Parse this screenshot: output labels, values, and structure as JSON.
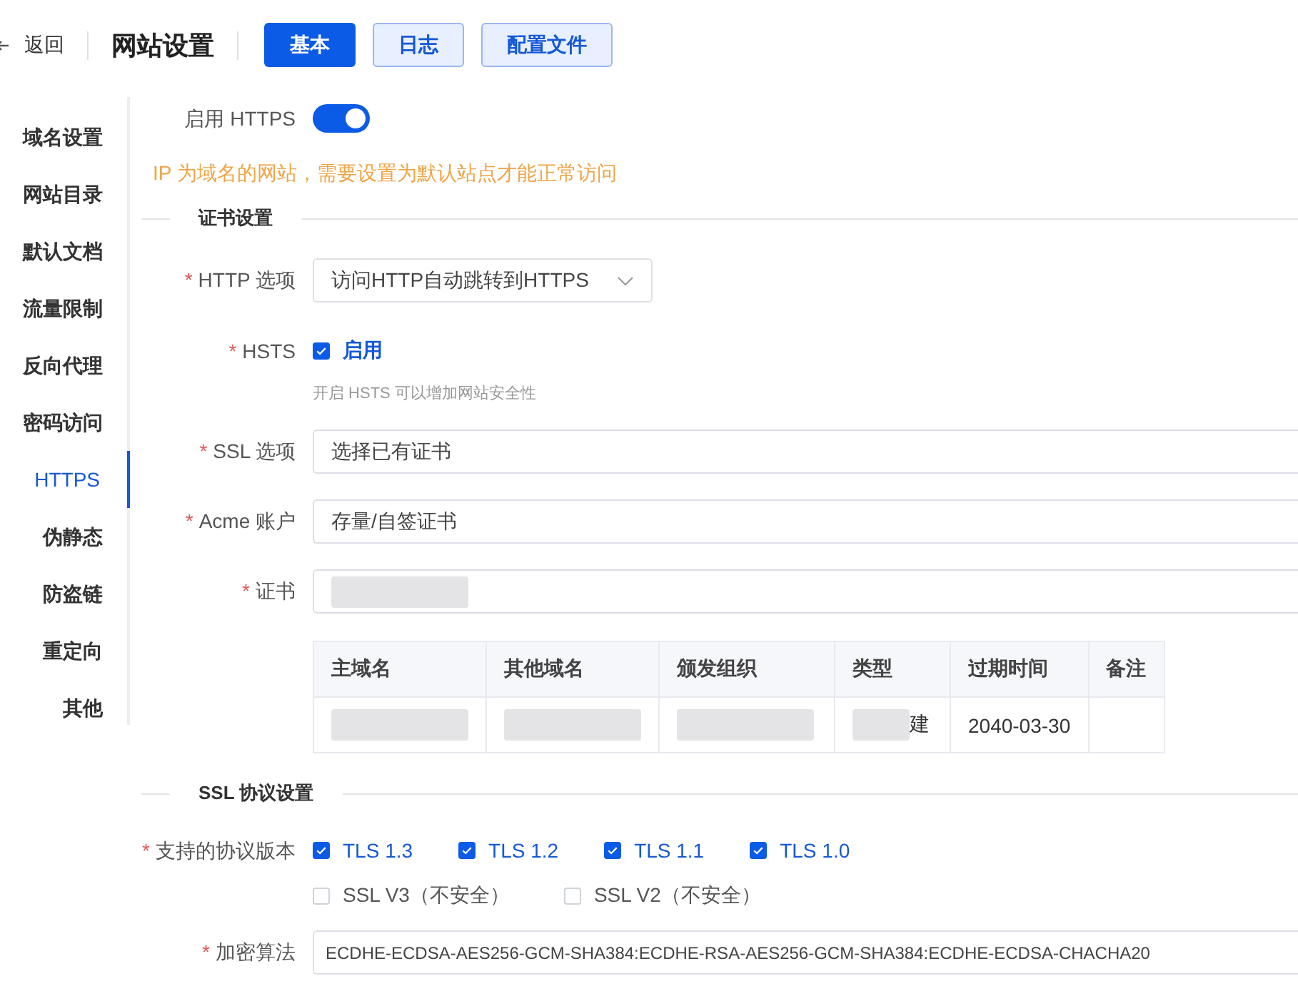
{
  "header": {
    "back": "返回",
    "title": "网站设置",
    "tabs": [
      {
        "label": "基本",
        "selected": true
      },
      {
        "label": "日志",
        "selected": false
      },
      {
        "label": "配置文件",
        "selected": false
      }
    ]
  },
  "sidebar": {
    "items": [
      {
        "label": "域名设置",
        "selected": false
      },
      {
        "label": "网站目录",
        "selected": false
      },
      {
        "label": "默认文档",
        "selected": false
      },
      {
        "label": "流量限制",
        "selected": false
      },
      {
        "label": "反向代理",
        "selected": false
      },
      {
        "label": "密码访问",
        "selected": false
      },
      {
        "label": "HTTPS",
        "selected": true
      },
      {
        "label": "伪静态",
        "selected": false
      },
      {
        "label": "防盗链",
        "selected": false
      },
      {
        "label": "重定向",
        "selected": false
      },
      {
        "label": "其他",
        "selected": false
      }
    ]
  },
  "https_toggle": {
    "label": "启用 HTTPS",
    "on": true
  },
  "warning": "IP 为域名的网站，需要设置为默认站点才能正常访问",
  "cert_section": {
    "title": "证书设置",
    "fields": [
      {
        "kind": "select",
        "label": "HTTP 选项",
        "required_mark": "*",
        "value": "访问HTTP自动跳转到HTTPS"
      },
      {
        "kind": "checkbox",
        "label": "HSTS",
        "required_mark": "*",
        "option": "启用",
        "checked": true,
        "hint": "开启 HSTS 可以增加网站安全性"
      },
      {
        "kind": "input",
        "label": "SSL 选项",
        "required_mark": "*",
        "value": "选择已有证书"
      },
      {
        "kind": "input",
        "label": "Acme 账户",
        "required_mark": "*",
        "value": "存量/自签证书"
      },
      {
        "kind": "redacted",
        "label": "证书",
        "required_mark": "*"
      }
    ],
    "table": {
      "columns": [
        "主域名",
        "其他域名",
        "颁发组织",
        "类型",
        "过期时间",
        "备注"
      ],
      "rows": [
        [
          {
            "redacted": true
          },
          {
            "redacted": true
          },
          {
            "redacted": true
          },
          {
            "redacted": true,
            "text": "建"
          },
          {
            "text": "2040-03-30"
          },
          {}
        ]
      ]
    }
  },
  "ssl_section": {
    "title": "SSL 协议设置",
    "protocols": {
      "label": "支持的协议版本",
      "required_mark": "*",
      "options": [
        [
          {
            "label": "TLS 1.3",
            "checked": true
          },
          {
            "label": "TLS 1.2",
            "checked": true
          },
          {
            "label": "TLS 1.1",
            "checked": true
          },
          {
            "label": "TLS 1.0",
            "checked": true
          }
        ],
        [
          {
            "label": "SSL V3（不安全）",
            "checked": false
          },
          {
            "label": "SSL V2（不安全）",
            "checked": false
          }
        ]
      ]
    },
    "cipher": {
      "label": "加密算法",
      "required_mark": "*",
      "value": "ECDHE-ECDSA-AES256-GCM-SHA384:ECDHE-RSA-AES256-GCM-SHA384:ECDHE-ECDSA-CHACHA20"
    }
  }
}
